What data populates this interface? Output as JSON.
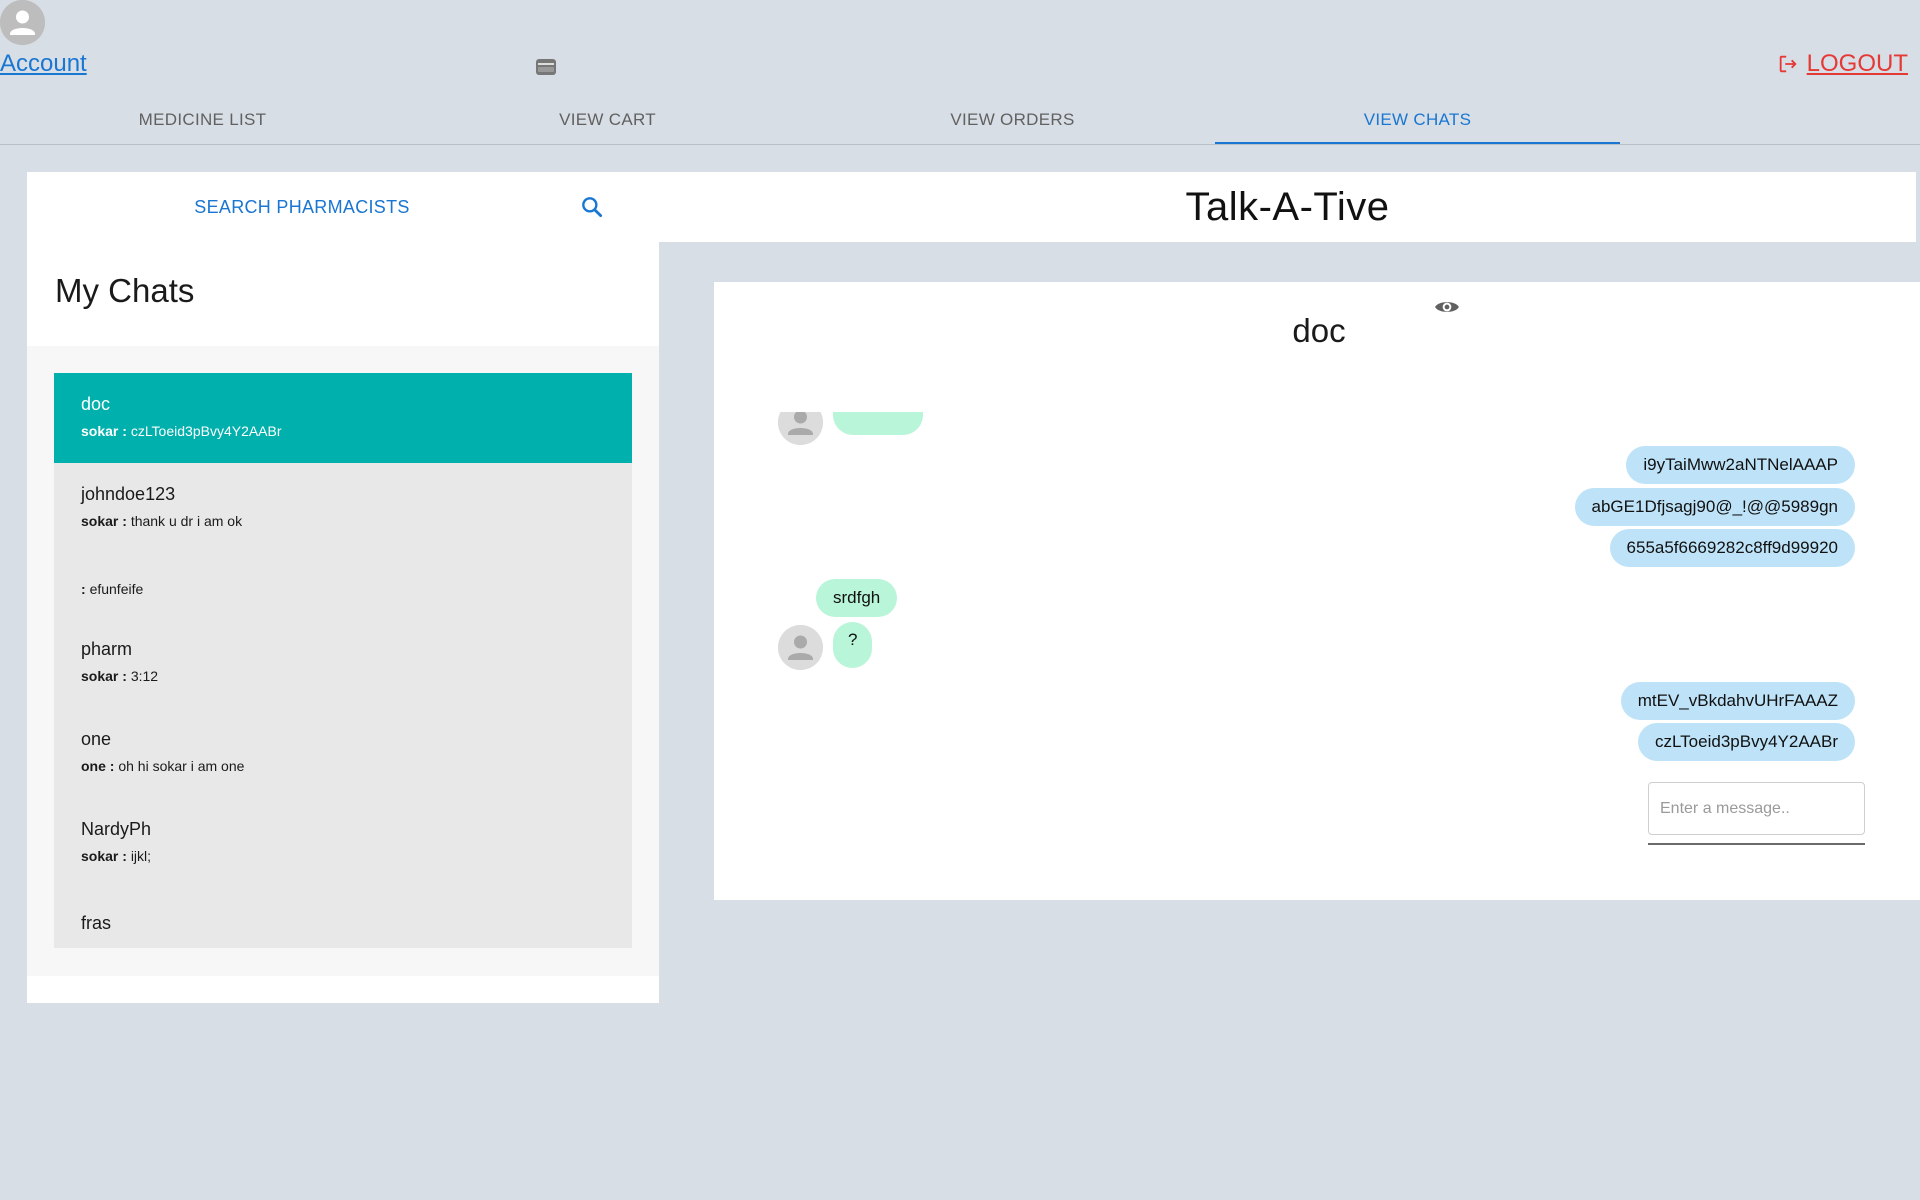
{
  "header": {
    "account_label": "Account",
    "logout_label": "LOGOUT",
    "colors": {
      "link": "#1976d2",
      "logout": "#e53935"
    }
  },
  "tabs": [
    {
      "label": "MEDICINE LIST",
      "active": false
    },
    {
      "label": "VIEW CART",
      "active": false
    },
    {
      "label": "VIEW ORDERS",
      "active": false
    },
    {
      "label": "VIEW CHATS",
      "active": true
    }
  ],
  "sidebar": {
    "search_label": "SEARCH PHARMACISTS",
    "title": "My Chats",
    "chats": [
      {
        "name": "doc",
        "sender": "sokar :",
        "last_message": "czLToeid3pBvy4Y2AABr",
        "selected": true
      },
      {
        "name": "johndoe123",
        "sender": "sokar :",
        "last_message": "thank u dr i am ok"
      },
      {
        "name": "",
        "sender": ":",
        "last_message": "efunfeife"
      },
      {
        "name": "pharm",
        "sender": "sokar :",
        "last_message": "3:12"
      },
      {
        "name": "one",
        "sender": "one :",
        "last_message": "oh hi sokar i am one"
      },
      {
        "name": "NardyPh",
        "sender": "sokar :",
        "last_message": "ijkl;"
      },
      {
        "name": "fras"
      }
    ],
    "selected_color": "#00b0ad"
  },
  "main": {
    "app_title": "Talk-A-Tive",
    "chat_title": "doc",
    "messages": [
      {
        "from": "them",
        "text": ""
      },
      {
        "from": "me",
        "text": "i9yTaiMww2aNTNelAAAP"
      },
      {
        "from": "me",
        "text": "abGE1Dfjsagj90@_!@@5989gn"
      },
      {
        "from": "me",
        "text": "655a5f6669282c8ff9d99920"
      },
      {
        "from": "them",
        "text": "srdfgh"
      },
      {
        "from": "them",
        "text": "?"
      },
      {
        "from": "me",
        "text": "mtEV_vBkdahvUHrFAAAZ"
      },
      {
        "from": "me",
        "text": "czLToeid3pBvy4Y2AABr"
      }
    ],
    "input_placeholder": "Enter a message..",
    "colors": {
      "my_bubble": "#bee3f8",
      "their_bubble": "#b9f5d8"
    }
  }
}
